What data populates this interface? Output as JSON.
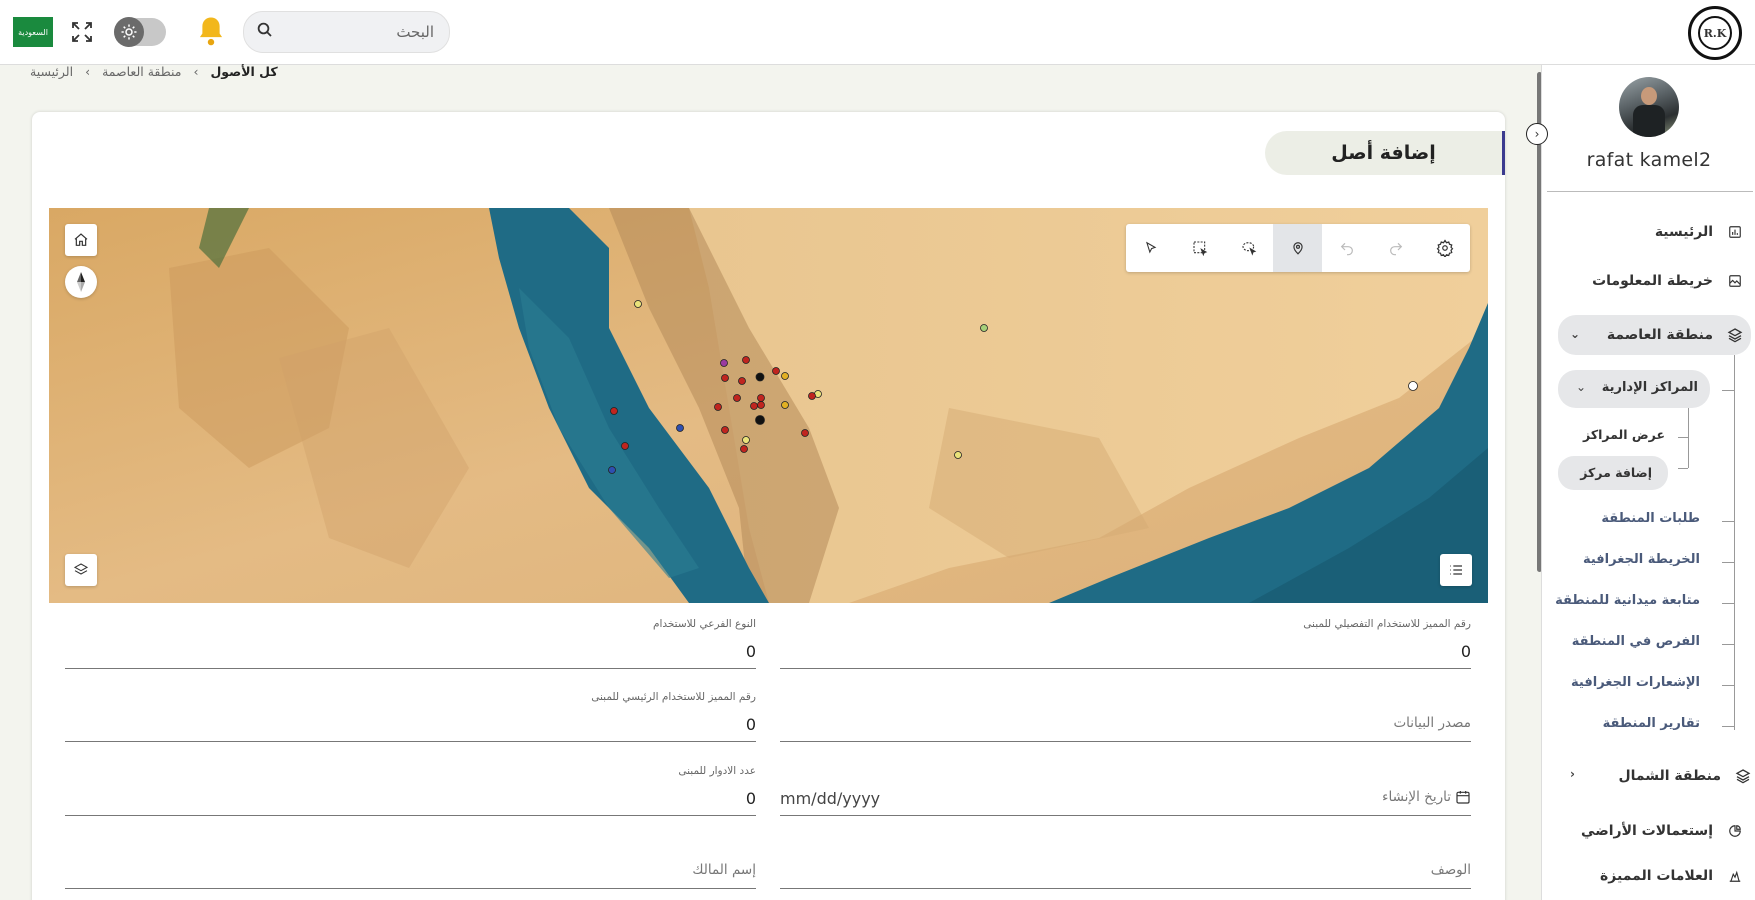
{
  "topbar": {
    "flag_text": "السعودية",
    "search_placeholder": "البحث",
    "logo_text": "R.K"
  },
  "sidebar": {
    "username": "rafat kamel2",
    "items": [
      {
        "label": "الرئيسية",
        "icon": "chart-icon"
      },
      {
        "label": "خريطة المعلومات",
        "icon": "image-icon"
      },
      {
        "label": "منطقة العاصمة",
        "icon": "layers-icon"
      },
      {
        "label": "منطقة الشمال",
        "icon": "layers-icon"
      },
      {
        "label": "إستعمالات الأراضي",
        "icon": "pie-chart-icon"
      },
      {
        "label": "العلامات المميزة",
        "icon": "landmark-icon"
      }
    ],
    "capital_sub": {
      "admin_centers": "المراكز الإدارية",
      "view_centers": "عرض المراكز",
      "add_center": "إضافة مركز"
    },
    "capital_links": [
      "طلبات المنطقة",
      "الخريطة الجغرافية",
      "متابعة ميدانية للمنطقة",
      "الفرص في المنطقة",
      "الإشعارات الجغرافية",
      "تقارير المنطقة"
    ]
  },
  "breadcrumb": {
    "home": "الرئيسية",
    "region": "منطقة العاصمة",
    "current": "كل الأصول"
  },
  "page": {
    "title": "إضافة أصل"
  },
  "map": {
    "tools": [
      "settings-icon",
      "redo-icon",
      "undo-icon",
      "pin-icon",
      "lasso-select-icon",
      "rect-select-icon",
      "pointer-icon"
    ],
    "active_tool": "pin-icon",
    "colors": {
      "sea": "#1f6b85",
      "land": "#e2b77e",
      "desert": "#ebc793"
    }
  },
  "form": {
    "detailed_use_code": {
      "label": "رقم المميز للاستخدام التفصيلي للمبنى",
      "value": "0"
    },
    "sub_use_type": {
      "label": "النوع الفرعي للاستخدام",
      "value": "0"
    },
    "data_source": {
      "placeholder": "مصدر البيانات"
    },
    "main_use_code": {
      "label": "رقم المميز للاستخدام الرئيسي للمبنى",
      "value": "0"
    },
    "creation_date": {
      "placeholder": "تاريخ الإنشاء",
      "value": "mm/dd/yyyy"
    },
    "floors_count": {
      "label": "عدد الادوار للمبنى",
      "value": "0"
    },
    "description": {
      "placeholder": "الوصف"
    },
    "owner_name": {
      "placeholder": "إسم المالك"
    }
  }
}
